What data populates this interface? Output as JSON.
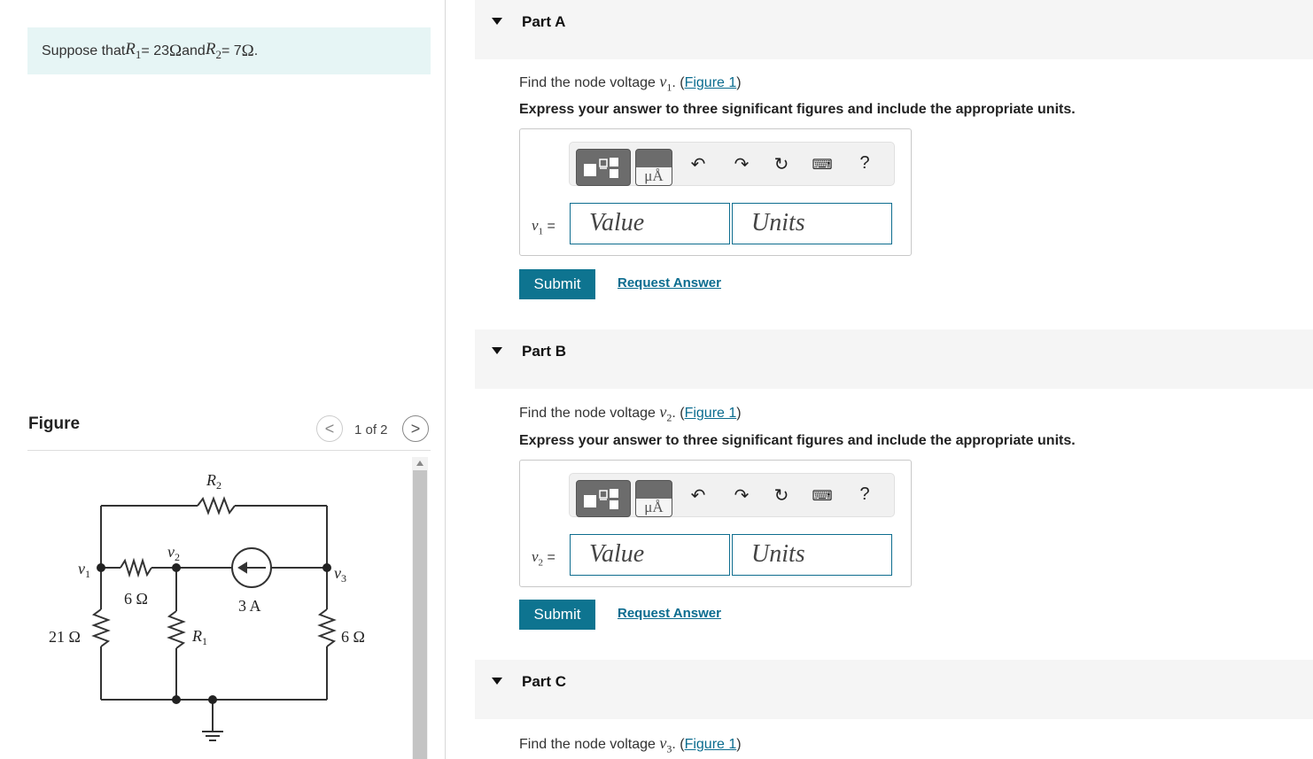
{
  "problem": {
    "prefix": "Suppose that ",
    "r1_var": "R",
    "r1_sub": "1",
    "r1_value": " = 23 ",
    "ohm": "Ω",
    "and": " and ",
    "r2_var": "R",
    "r2_sub": "2",
    "r2_value": " = 7 ",
    "suffix": "."
  },
  "figure": {
    "title": "Figure",
    "pager_label": "1 of 2",
    "prev_glyph": "<",
    "next_glyph": ">",
    "circuit_labels": {
      "r2": "R",
      "r2_sub": "2",
      "v1": "v",
      "v1_sub": "1",
      "v2": "v",
      "v2_sub": "2",
      "v3": "v",
      "v3_sub": "3",
      "res_6a": "6 Ω",
      "current": "3 A",
      "res_21": "21 Ω",
      "r1": "R",
      "r1_sub": "1",
      "res_6b": "6 Ω"
    }
  },
  "parts": [
    {
      "title": "Part A",
      "question_prefix": "Find the node voltage ",
      "var": "v",
      "var_sub": "1",
      "question_mid": ". (",
      "figure_link": "Figure 1",
      "question_suffix": ")",
      "instruction": "Express your answer to three significant figures and include the appropriate units.",
      "value_placeholder": "Value",
      "units_placeholder": "Units",
      "var_label": "v",
      "var_label_sub": "1",
      "eq": " =",
      "submit_label": "Submit",
      "request_label": "Request Answer"
    },
    {
      "title": "Part B",
      "question_prefix": "Find the node voltage ",
      "var": "v",
      "var_sub": "2",
      "question_mid": ". (",
      "figure_link": "Figure 1",
      "question_suffix": ")",
      "instruction": "Express your answer to three significant figures and include the appropriate units.",
      "value_placeholder": "Value",
      "units_placeholder": "Units",
      "var_label": "v",
      "var_label_sub": "2",
      "eq": " =",
      "submit_label": "Submit",
      "request_label": "Request Answer"
    },
    {
      "title": "Part C",
      "question_prefix": "Find the node voltage ",
      "var": "v",
      "var_sub": "3",
      "question_mid": ". (",
      "figure_link": "Figure 1",
      "question_suffix": ")"
    }
  ],
  "toolbar": {
    "units_button_label": "μÅ",
    "help_label": "?",
    "icons": [
      "templates-icon",
      "units-icon",
      "undo-icon",
      "redo-icon",
      "reset-icon",
      "keyboard-icon",
      "help-icon"
    ]
  }
}
